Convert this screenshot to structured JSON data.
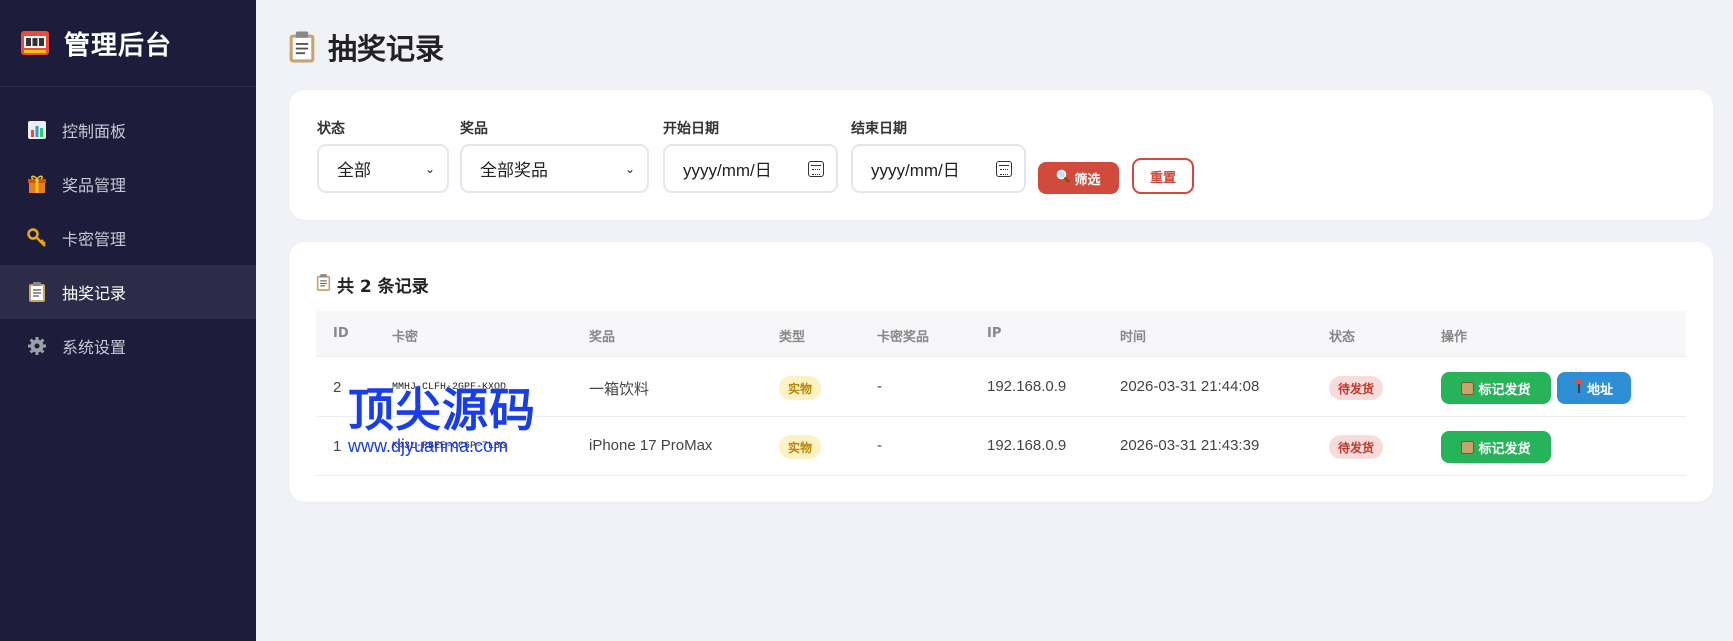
{
  "sidebar": {
    "brand_icon": "slot-machine-icon",
    "brand_title": "管理后台",
    "items": [
      {
        "label": "控制面板",
        "icon": "bar-chart-icon"
      },
      {
        "label": "奖品管理",
        "icon": "gift-icon"
      },
      {
        "label": "卡密管理",
        "icon": "key-icon"
      },
      {
        "label": "抽奖记录",
        "icon": "clipboard-icon",
        "active": true
      },
      {
        "label": "系统设置",
        "icon": "gear-icon"
      }
    ]
  },
  "page": {
    "title": "抽奖记录",
    "icon": "clipboard-icon"
  },
  "filters": {
    "status": {
      "label": "状态",
      "value": "全部"
    },
    "prize": {
      "label": "奖品",
      "value": "全部奖品"
    },
    "start_date": {
      "label": "开始日期",
      "placeholder": "yyyy/mm/日"
    },
    "end_date": {
      "label": "结束日期",
      "placeholder": "yyyy/mm/日"
    },
    "filter_button": "筛选",
    "reset_button": "重置"
  },
  "records": {
    "summary": "共 2 条记录",
    "columns": [
      "ID",
      "卡密",
      "奖品",
      "类型",
      "卡密奖品",
      "IP",
      "时间",
      "状态",
      "操作"
    ],
    "rows": [
      {
        "id": "2",
        "card": "MMHJ-CLFH-2GPF-KXQD",
        "prize": "一箱饮料",
        "type": "实物",
        "card_prize": "-",
        "ip": "192.168.0.9",
        "time": "2026-03-31 21:44:08",
        "status": "待发货",
        "actions": [
          "标记发货",
          "地址"
        ]
      },
      {
        "id": "1",
        "card": "K43L-RBEE-CC6P-7L8G",
        "prize": "iPhone 17 ProMax",
        "type": "实物",
        "card_prize": "-",
        "ip": "192.168.0.9",
        "time": "2026-03-31 21:43:39",
        "status": "待发货",
        "actions": [
          "标记发货"
        ]
      }
    ]
  },
  "watermark": {
    "logo": "顶尖源码",
    "url": "www.djyuanma.com"
  }
}
